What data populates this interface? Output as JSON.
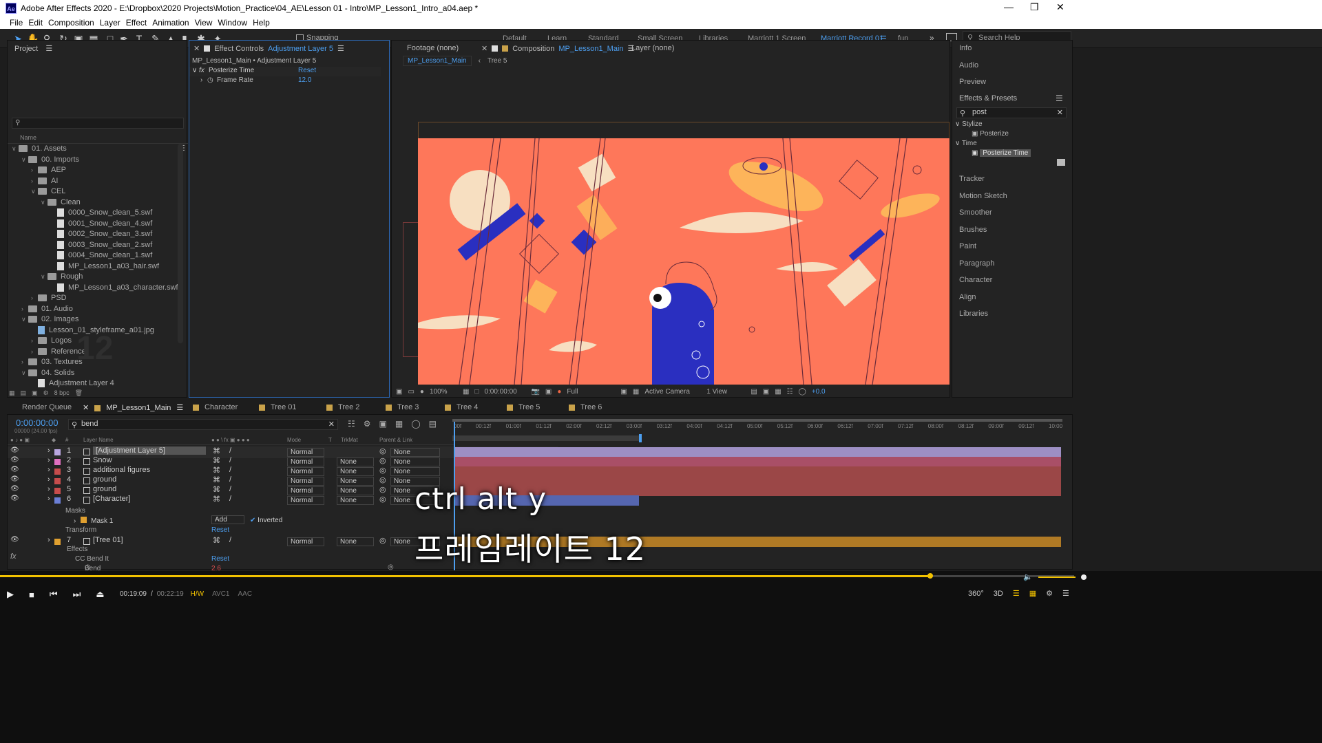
{
  "window": {
    "title": "Adobe After Effects 2020 - E:\\Dropbox\\2020 Projects\\Motion_Practice\\04_AE\\Lesson 01 - Intro\\MP_Lesson1_Intro_a04.aep *",
    "app_icon": "Ae"
  },
  "menu": [
    "File",
    "Edit",
    "Composition",
    "Layer",
    "Effect",
    "Animation",
    "View",
    "Window",
    "Help"
  ],
  "toolbar": {
    "snapping": "Snapping"
  },
  "workspaces": [
    "Default",
    "Learn",
    "Standard",
    "Small Screen",
    "Libraries",
    "Marriott 1 Screen",
    "Marriott Record 01",
    "fun"
  ],
  "search_help": "Search Help",
  "project": {
    "title": "Project",
    "column": "Name",
    "bpc": "8 bpc",
    "items": [
      {
        "label": "01. Assets",
        "kind": "folder",
        "indent": 0,
        "open": true
      },
      {
        "label": "00. Imports",
        "kind": "folder",
        "indent": 1,
        "open": true
      },
      {
        "label": "AEP",
        "kind": "folder",
        "indent": 2,
        "open": false
      },
      {
        "label": "AI",
        "kind": "folder",
        "indent": 2,
        "open": false
      },
      {
        "label": "CEL",
        "kind": "folder",
        "indent": 2,
        "open": true
      },
      {
        "label": "Clean",
        "kind": "folder",
        "indent": 3,
        "open": true
      },
      {
        "label": "0000_Snow_clean_5.swf",
        "kind": "file",
        "indent": 4
      },
      {
        "label": "0001_Snow_clean_4.swf",
        "kind": "file",
        "indent": 4
      },
      {
        "label": "0002_Snow_clean_3.swf",
        "kind": "file",
        "indent": 4
      },
      {
        "label": "0003_Snow_clean_2.swf",
        "kind": "file",
        "indent": 4
      },
      {
        "label": "0004_Snow_clean_1.swf",
        "kind": "file",
        "indent": 4
      },
      {
        "label": "MP_Lesson1_a03_hair.swf",
        "kind": "file",
        "indent": 4
      },
      {
        "label": "Rough",
        "kind": "folder",
        "indent": 3,
        "open": true
      },
      {
        "label": "MP_Lesson1_a03_character.swf",
        "kind": "file",
        "indent": 4
      },
      {
        "label": "PSD",
        "kind": "folder",
        "indent": 2,
        "open": false
      },
      {
        "label": "01. Audio",
        "kind": "folder",
        "indent": 1,
        "open": false
      },
      {
        "label": "02. Images",
        "kind": "folder",
        "indent": 1,
        "open": true
      },
      {
        "label": "Lesson_01_styleframe_a01.jpg",
        "kind": "image",
        "indent": 2
      },
      {
        "label": "Logos",
        "kind": "folder",
        "indent": 2,
        "open": false
      },
      {
        "label": "Reference",
        "kind": "folder",
        "indent": 2,
        "open": false
      },
      {
        "label": "03. Textures",
        "kind": "folder",
        "indent": 1,
        "open": false
      },
      {
        "label": "04. Solids",
        "kind": "folder",
        "indent": 1,
        "open": true
      },
      {
        "label": "Adjustment Layer 4",
        "kind": "solid",
        "indent": 2
      }
    ],
    "watermark": "12"
  },
  "effect_controls": {
    "tab": "Effect Controls",
    "tab_layer": "Adjustment Layer 5",
    "path": "MP_Lesson1_Main • Adjustment Layer 5",
    "effect": "Posterize Time",
    "reset": "Reset",
    "prop": "Frame Rate",
    "value": "12.0"
  },
  "viewer": {
    "footage_tab": "Footage  (none)",
    "comp_tab": "Composition",
    "comp_name": "MP_Lesson1_Main",
    "layer_tab": "Layer  (none)",
    "crumb1": "MP_Lesson1_Main",
    "crumb2": "Tree 5",
    "zoom": "100%",
    "time": "0:00:00:00",
    "resolution": "Full",
    "camera": "Active Camera",
    "views": "1 View",
    "exposure": "+0.0",
    "bg_color": "#fe775a"
  },
  "right_panel": {
    "items_top": [
      "Info",
      "Audio",
      "Preview"
    ],
    "effects_title": "Effects & Presets",
    "search": "post",
    "stylize": "Stylize",
    "posterize": "Posterize",
    "time": "Time",
    "posterize_time": "Posterize Time",
    "items_bottom": [
      "Tracker",
      "Motion Sketch",
      "Smoother",
      "Brushes",
      "Paint",
      "Paragraph",
      "Character",
      "Align",
      "Libraries"
    ]
  },
  "timeline_tabs": {
    "render": "Render Queue",
    "tabs": [
      {
        "label": "MP_Lesson1_Main",
        "color": "#c9a24a",
        "active": true
      },
      {
        "label": "Character",
        "color": "#c9a24a"
      },
      {
        "label": "Tree 01",
        "color": "#c9a24a"
      },
      {
        "label": "Tree 2",
        "color": "#c9a24a"
      },
      {
        "label": "Tree 3",
        "color": "#c9a24a"
      },
      {
        "label": "Tree 4",
        "color": "#c9a24a"
      },
      {
        "label": "Tree 5",
        "color": "#c9a24a"
      },
      {
        "label": "Tree 6",
        "color": "#c9a24a"
      }
    ]
  },
  "timeline": {
    "timecode": "0:00:00:00",
    "fps": "00000 (24.00 fps)",
    "search": "bend",
    "headers": {
      "layer_name": "Layer Name",
      "mode": "Mode",
      "t": "T",
      "trkmat": "TrkMat",
      "parent": "Parent & Link"
    },
    "ruler": [
      "00f",
      "00:12f",
      "01:00f",
      "01:12f",
      "02:00f",
      "02:12f",
      "03:00f",
      "03:12f",
      "04:00f",
      "04:12f",
      "05:00f",
      "05:12f",
      "06:00f",
      "06:12f",
      "07:00f",
      "07:12f",
      "08:00f",
      "08:12f",
      "09:00f",
      "09:12f",
      "10:00"
    ],
    "layers": [
      {
        "num": "1",
        "name": "[Adjustment Layer 5]",
        "color": "#b9a6e0",
        "mode": "Normal",
        "trkmat": "",
        "parent": "None",
        "bar": "#9d8fc4",
        "bar_end": 1.0,
        "selected": true
      },
      {
        "num": "2",
        "name": "Snow",
        "color": "#e06fc0",
        "mode": "Normal",
        "trkmat": "None",
        "parent": "None",
        "bar": "#a94f67",
        "bar_end": 1.0
      },
      {
        "num": "3",
        "name": "additional figures",
        "color": "#c74c4c",
        "mode": "Normal",
        "trkmat": "None",
        "parent": "None",
        "bar": "#9b4747",
        "bar_end": 1.0
      },
      {
        "num": "4",
        "name": "ground",
        "color": "#c74c4c",
        "mode": "Normal",
        "trkmat": "None",
        "parent": "None",
        "bar": "#9b4747",
        "bar_end": 1.0
      },
      {
        "num": "5",
        "name": "ground",
        "color": "#c74c4c",
        "mode": "Normal",
        "trkmat": "None",
        "parent": "None",
        "bar": "#9b4747",
        "bar_end": 1.0
      },
      {
        "num": "6",
        "name": "[Character]",
        "color": "#6b7fd6",
        "mode": "Normal",
        "trkmat": "None",
        "parent": "None",
        "bar": "#5566b0",
        "bar_end": 0.305
      }
    ],
    "mask_group": "Masks",
    "mask": "Mask 1",
    "mask_mode": "Add",
    "inverted": "Inverted",
    "transform": "Transform",
    "reset": "Reset",
    "layer7": {
      "num": "7",
      "name": "[Tree 01]",
      "color": "#e0a030",
      "mode": "Normal",
      "trkmat": "None",
      "parent": "None",
      "bar": "#b07a25"
    },
    "effects": "Effects",
    "effect_name": "CC Bend It",
    "prop": "Bend",
    "prop_value": "2.6"
  },
  "overlay": {
    "line1": "ctrl alt y",
    "line2": "프레임레이트 12"
  },
  "player": {
    "time": "00:19:09",
    "duration": "00:22:19",
    "hw": "H/W",
    "codec": "AVC1",
    "audio": "AAC",
    "progress": 0.866
  }
}
